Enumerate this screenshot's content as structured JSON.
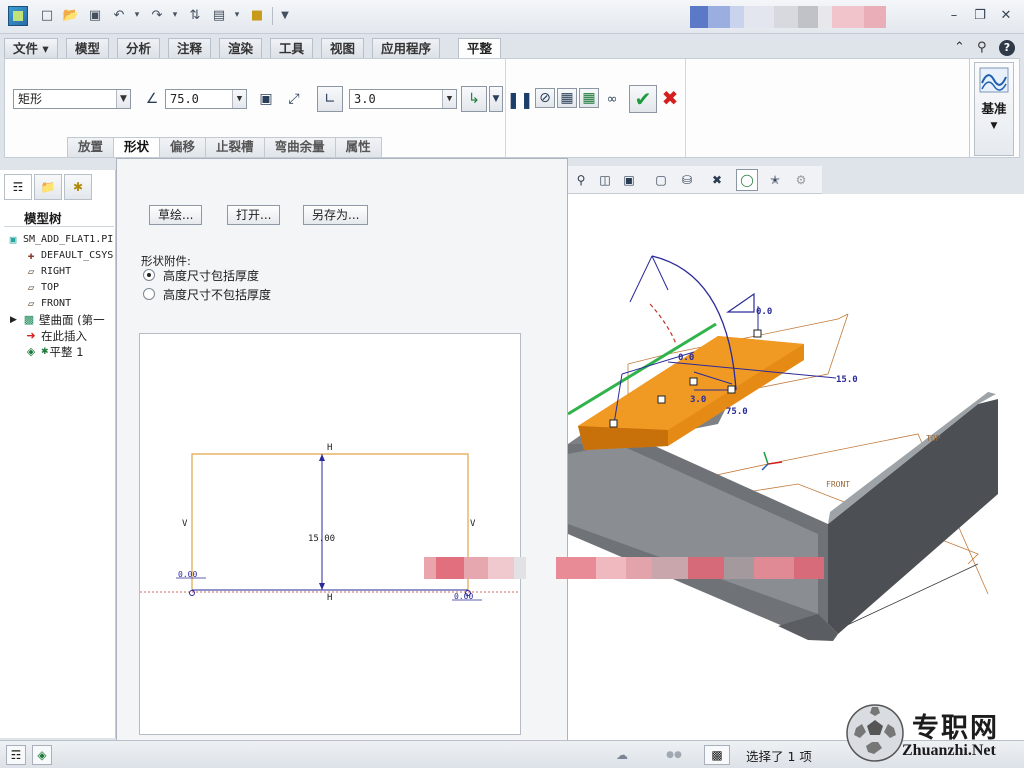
{
  "titlebar": {
    "icons": [
      "app-icon",
      "new-icon",
      "open-icon",
      "save-icon",
      "undo-icon",
      "redo-icon",
      "regenerate-icon",
      "windows-icon",
      "close-window-icon",
      "customize-icon"
    ]
  },
  "tabs": {
    "file": "文件",
    "items": [
      "模型",
      "分析",
      "注释",
      "渲染",
      "工具",
      "视图",
      "应用程序"
    ],
    "active": "平整"
  },
  "ribbon": {
    "shape_type": "矩形",
    "angle_value": "75.0",
    "thickness_value": "3.0",
    "subtabs": [
      "放置",
      "形状",
      "偏移",
      "止裂槽",
      "弯曲余量",
      "属性"
    ],
    "datum_label": "基准"
  },
  "model_tree": {
    "title": "模型树",
    "items": [
      {
        "label": "SM_ADD_FLAT1.PI",
        "icon": "part-icon"
      },
      {
        "label": "DEFAULT_CSYS",
        "icon": "csys-icon"
      },
      {
        "label": "RIGHT",
        "icon": "plane-icon"
      },
      {
        "label": "TOP",
        "icon": "plane-icon"
      },
      {
        "label": "FRONT",
        "icon": "plane-icon"
      },
      {
        "label": "壁曲面 (第一",
        "icon": "wall-icon"
      },
      {
        "label": "在此插入",
        "icon": "insert-arrow-icon"
      },
      {
        "label": "平整 1",
        "icon": "flat-wall-icon"
      }
    ]
  },
  "dialog": {
    "buttons": [
      "草绘...",
      "打开...",
      "另存为..."
    ],
    "attach_label": "形状附件:",
    "radio_options": [
      {
        "label": "高度尺寸包括厚度",
        "selected": true
      },
      {
        "label": "高度尺寸不包括厚度",
        "selected": false
      }
    ],
    "sketch": {
      "h_label": "H",
      "v_label": "V",
      "height_dim": "15.00",
      "zero_dim": "0.00"
    }
  },
  "viewport": {
    "dims": {
      "d1": "0.0",
      "d2": "0.0",
      "d3": "15.0",
      "d4": "3.0",
      "d5": "75.0"
    },
    "plane_labels": {
      "top": "TOP",
      "front": "FRONT"
    }
  },
  "status": {
    "text": "选择了 1 项"
  },
  "watermark": {
    "cn": "专职网",
    "en": "Zhuanzhi.Net"
  },
  "colors": {
    "accent_green": "#1d9c3c",
    "cancel_red": "#d41f1f",
    "orange_wall": "#e58a14",
    "sketch_orange": "#e0a545",
    "dim_blue": "#2a2a9a"
  }
}
